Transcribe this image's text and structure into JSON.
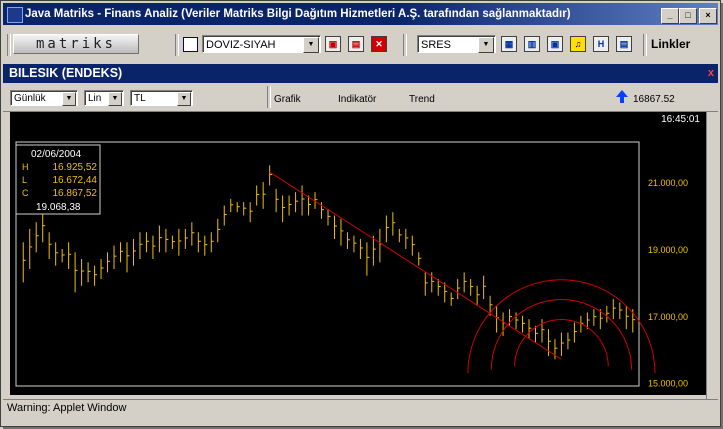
{
  "window": {
    "title": "Java Matriks - Finans Analiz (Veriler Matriks Bilgi Dağıtım Hizmetleri A.Ş. tarafından sağlanmaktadır)",
    "minimize": "_",
    "maximize": "□",
    "close": "×"
  },
  "toolbar": {
    "logo": "matriks",
    "theme_select": "DOVIZ-SIYAH",
    "series_select": "SRES",
    "links_label": "Linkler",
    "buttons": [
      "save-icon",
      "print-icon",
      "delete-icon",
      "grid-icon",
      "chart-icon",
      "window-icon",
      "bell-icon",
      "h-icon",
      "calc-icon"
    ]
  },
  "panel": {
    "title": "BILESIK (ENDEKS)",
    "close": "x"
  },
  "controls": {
    "period": "Günlük",
    "scale": "Lin",
    "currency": "TL",
    "menu_grafik": "Grafik",
    "menu_indikator": "Indikatör",
    "menu_trend": "Trend",
    "last_price": "16867.52",
    "time": "16:45:01"
  },
  "infobox": {
    "date": "02/06/2004",
    "h_label": "H",
    "h_value": "16.925,52",
    "l_label": "L",
    "l_value": "16.672,44",
    "c_label": "C",
    "c_value": "16.867,52",
    "cursor_value": "19.068,38"
  },
  "chart_data": {
    "type": "ohlc",
    "yticks": [
      "21.000,00",
      "19.000,00",
      "17.000,00",
      "15.000,00"
    ],
    "ytick_values": [
      21000,
      19000,
      17000,
      15000
    ],
    "ylim": [
      14900,
      22200
    ],
    "bar_color": "#f0c000",
    "trend_color": "#d00000",
    "bars": [
      [
        18000,
        19200
      ],
      [
        18400,
        19600
      ],
      [
        18900,
        19800
      ],
      [
        19200,
        20100
      ],
      [
        18700,
        19500
      ],
      [
        18500,
        19200
      ],
      [
        18600,
        19000
      ],
      [
        18400,
        19200
      ],
      [
        17700,
        18900
      ],
      [
        17900,
        18700
      ],
      [
        18000,
        18600
      ],
      [
        17900,
        18500
      ],
      [
        18100,
        18700
      ],
      [
        18300,
        18900
      ],
      [
        18400,
        19100
      ],
      [
        18600,
        19200
      ],
      [
        18300,
        19200
      ],
      [
        18500,
        19300
      ],
      [
        18700,
        19500
      ],
      [
        18900,
        19500
      ],
      [
        18700,
        19400
      ],
      [
        18900,
        19700
      ],
      [
        18900,
        19600
      ],
      [
        19000,
        19400
      ],
      [
        18800,
        19600
      ],
      [
        19000,
        19600
      ],
      [
        19100,
        19800
      ],
      [
        18900,
        19500
      ],
      [
        18800,
        19400
      ],
      [
        18900,
        19500
      ],
      [
        19200,
        19900
      ],
      [
        19700,
        20300
      ],
      [
        20100,
        20500
      ],
      [
        20100,
        20400
      ],
      [
        20000,
        20400
      ],
      [
        19800,
        20400
      ],
      [
        20300,
        20900
      ],
      [
        20200,
        21000
      ],
      [
        20900,
        21500
      ],
      [
        20100,
        20800
      ],
      [
        19800,
        20600
      ],
      [
        20000,
        20600
      ],
      [
        20100,
        20700
      ],
      [
        20000,
        20900
      ],
      [
        20000,
        20600
      ],
      [
        20200,
        20700
      ],
      [
        19900,
        20400
      ],
      [
        19700,
        20200
      ],
      [
        19300,
        20000
      ],
      [
        19100,
        19900
      ],
      [
        19000,
        19500
      ],
      [
        18900,
        19400
      ],
      [
        18700,
        19300
      ],
      [
        18200,
        19200
      ],
      [
        18500,
        19400
      ],
      [
        18600,
        19600
      ],
      [
        19200,
        20000
      ],
      [
        19400,
        20100
      ],
      [
        19200,
        19600
      ],
      [
        19000,
        19600
      ],
      [
        18800,
        19400
      ],
      [
        18500,
        18900
      ],
      [
        17600,
        18300
      ],
      [
        17700,
        18300
      ],
      [
        17600,
        18100
      ],
      [
        17400,
        18000
      ],
      [
        17300,
        17700
      ],
      [
        17500,
        18100
      ],
      [
        17700,
        18300
      ],
      [
        17600,
        18100
      ],
      [
        17300,
        17900
      ],
      [
        17500,
        18200
      ],
      [
        17000,
        17600
      ],
      [
        16500,
        17300
      ],
      [
        16400,
        17100
      ],
      [
        16700,
        17200
      ],
      [
        16600,
        17100
      ],
      [
        16500,
        17000
      ],
      [
        16300,
        16900
      ],
      [
        16200,
        16700
      ],
      [
        16200,
        16900
      ],
      [
        15800,
        16600
      ],
      [
        15700,
        16300
      ],
      [
        15800,
        16500
      ],
      [
        16000,
        16500
      ],
      [
        16200,
        16800
      ],
      [
        16500,
        17000
      ],
      [
        16600,
        17100
      ],
      [
        16700,
        17200
      ],
      [
        16600,
        17200
      ],
      [
        16800,
        17300
      ],
      [
        16900,
        17500
      ],
      [
        16900,
        17400
      ],
      [
        16600,
        17300
      ],
      [
        16500,
        17200
      ]
    ],
    "trendline": [
      [
        38,
        21300
      ],
      [
        83,
        15700
      ]
    ],
    "arcs_center": [
      83,
      15700
    ],
    "arcs_radii_value": [
      1400,
      2100,
      2800
    ]
  },
  "status": {
    "text": "Warning: Applet Window"
  }
}
